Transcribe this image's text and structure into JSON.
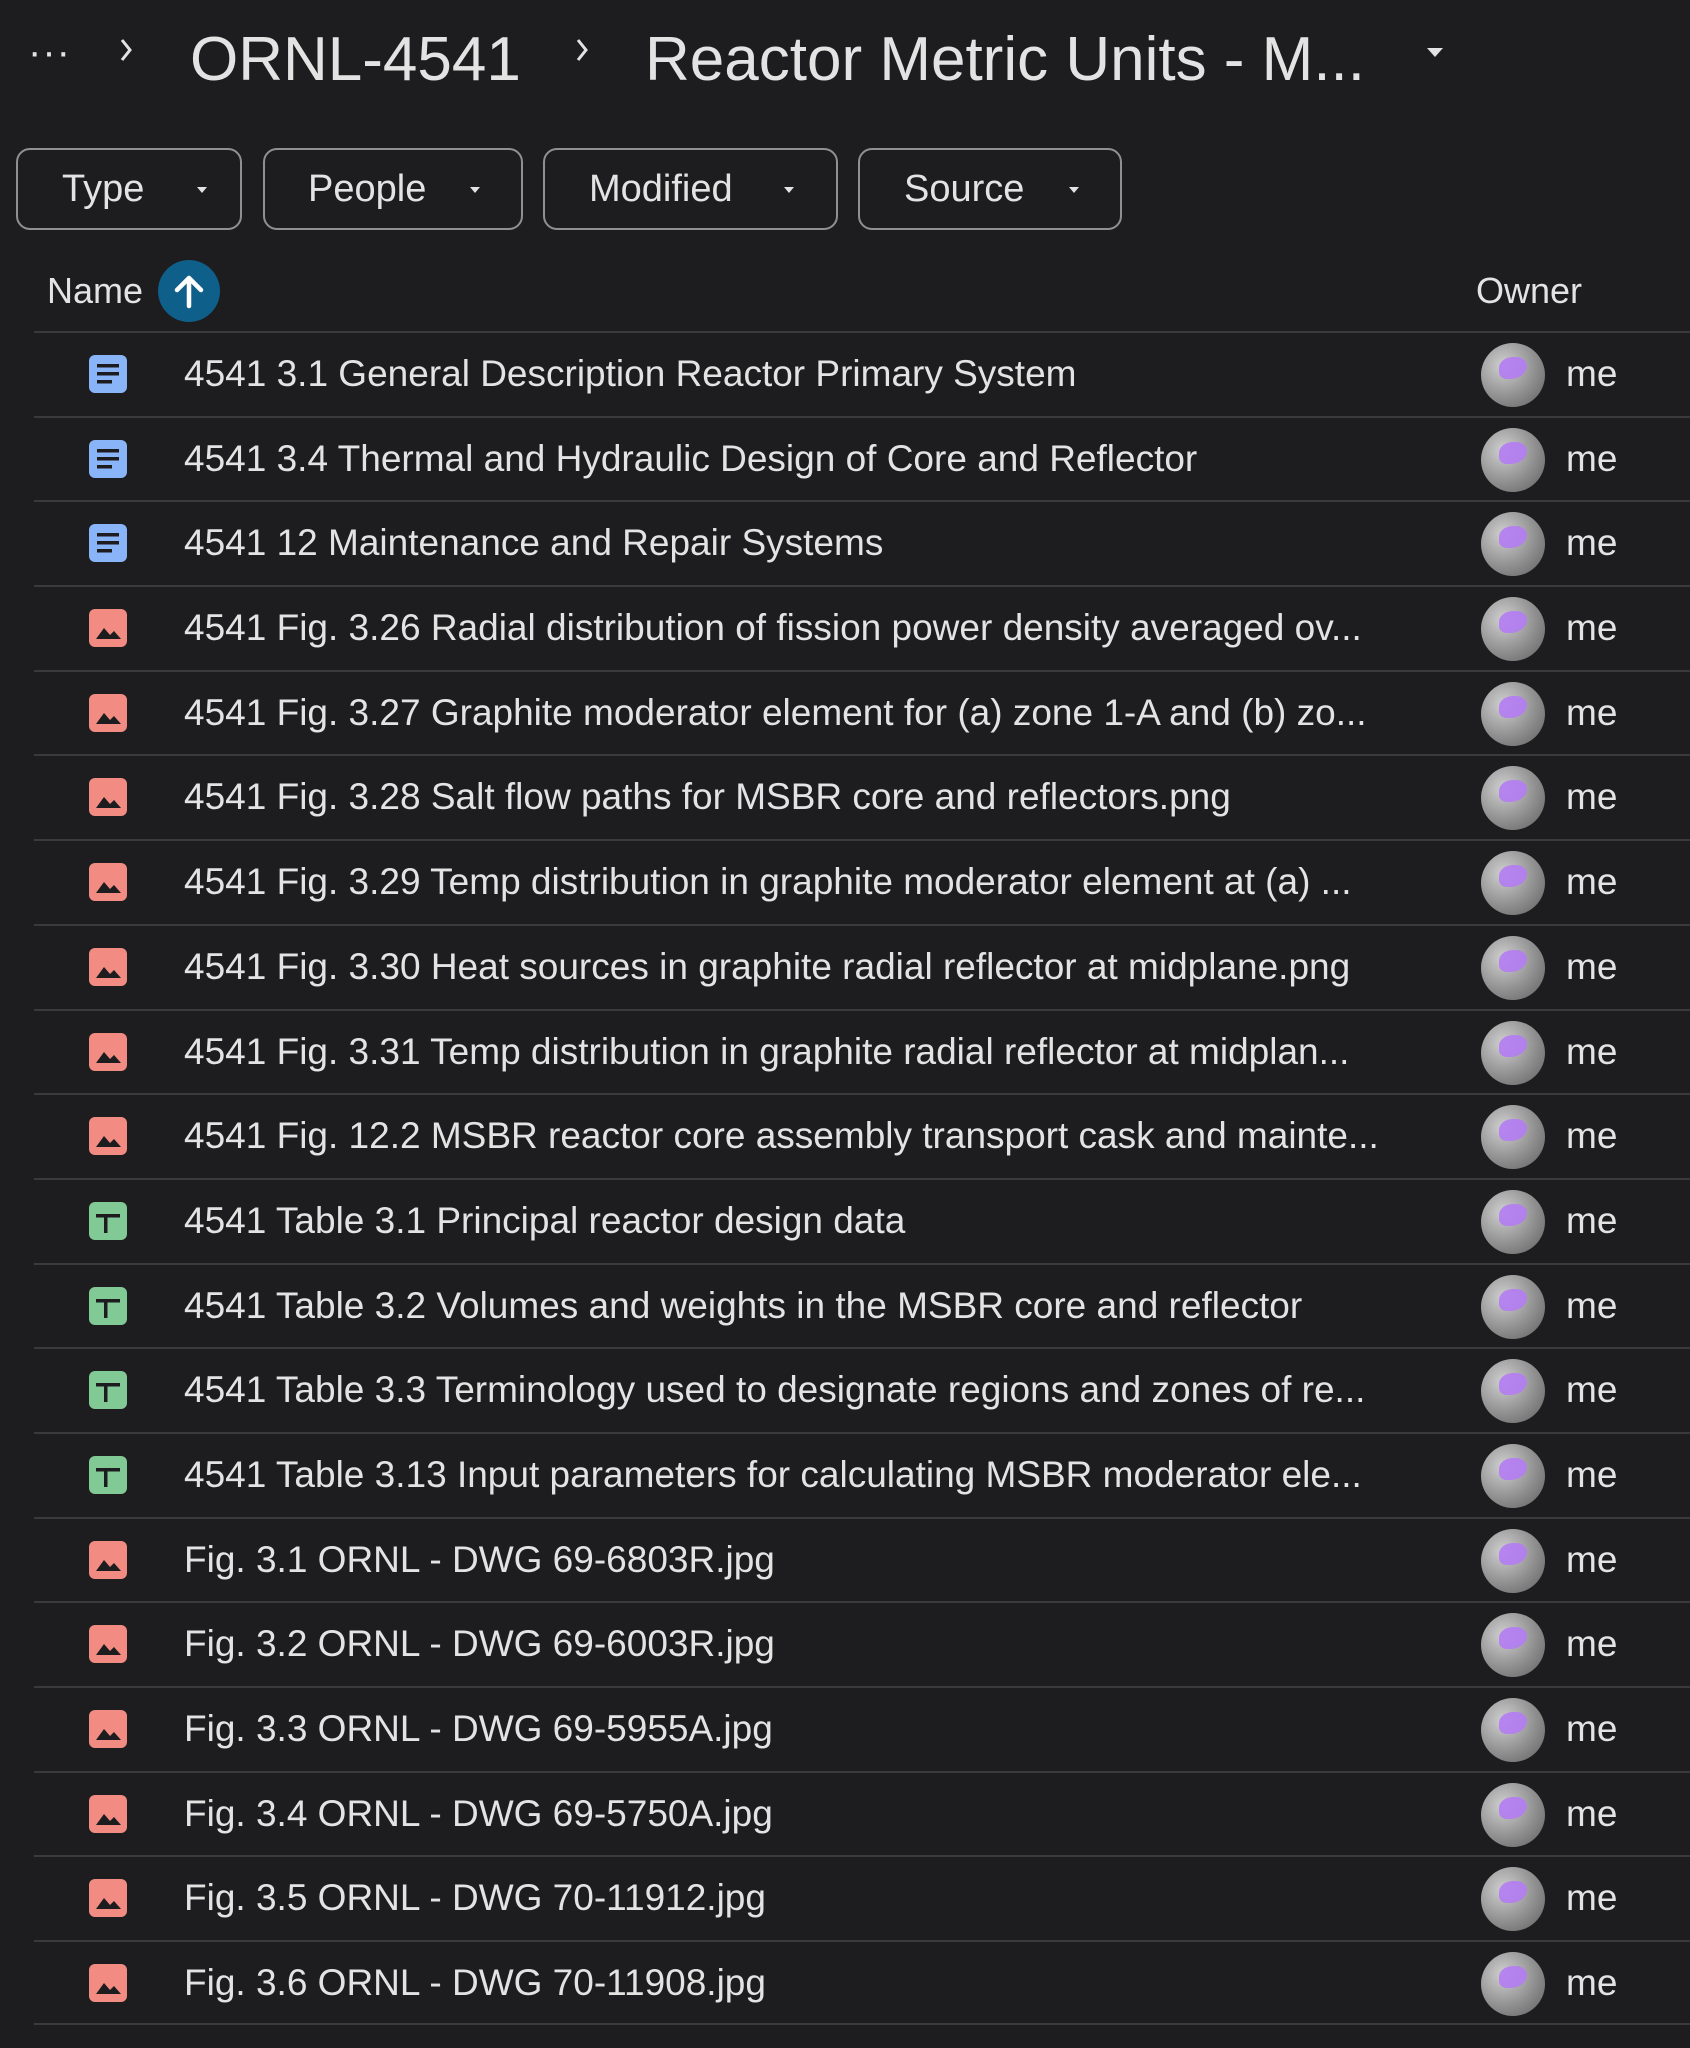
{
  "breadcrumb": {
    "more": "···",
    "items": [
      "ORNL-4541",
      "Reactor Metric Units - M..."
    ]
  },
  "filters": [
    "Type",
    "People",
    "Modified",
    "Source"
  ],
  "columns": {
    "name": "Name",
    "owner": "Owner"
  },
  "colors": {
    "doc": "#8ab4f8",
    "image": "#f28b82",
    "sheet": "#81c995",
    "sort_button": "#0e5f8a"
  },
  "files": [
    {
      "type": "doc",
      "name": "4541 3.1 General Description Reactor Primary System",
      "owner": "me"
    },
    {
      "type": "doc",
      "name": "4541 3.4 Thermal and Hydraulic Design of Core and Reflector",
      "owner": "me"
    },
    {
      "type": "doc",
      "name": "4541 12 Maintenance and Repair Systems",
      "owner": "me"
    },
    {
      "type": "image",
      "name": "4541 Fig. 3.26 Radial distribution of fission power density averaged ov...",
      "owner": "me"
    },
    {
      "type": "image",
      "name": "4541 Fig. 3.27 Graphite moderator element for (a) zone 1-A and (b) zo...",
      "owner": "me"
    },
    {
      "type": "image",
      "name": "4541 Fig. 3.28 Salt flow paths for MSBR core and reflectors.png",
      "owner": "me"
    },
    {
      "type": "image",
      "name": "4541 Fig. 3.29 Temp distribution in graphite moderator element at (a) ...",
      "owner": "me"
    },
    {
      "type": "image",
      "name": "4541 Fig. 3.30 Heat sources in graphite radial reflector at midplane.png",
      "owner": "me"
    },
    {
      "type": "image",
      "name": "4541 Fig. 3.31 Temp distribution in graphite radial reflector at midplan...",
      "owner": "me"
    },
    {
      "type": "image",
      "name": "4541 Fig. 12.2 MSBR reactor core assembly transport cask and mainte...",
      "owner": "me"
    },
    {
      "type": "sheet",
      "name": "4541 Table 3.1 Principal reactor design data",
      "owner": "me"
    },
    {
      "type": "sheet",
      "name": "4541 Table 3.2 Volumes and weights in the MSBR core and reflector",
      "owner": "me"
    },
    {
      "type": "sheet",
      "name": "4541 Table 3.3 Terminology used to designate regions and zones of re...",
      "owner": "me"
    },
    {
      "type": "sheet",
      "name": "4541 Table 3.13 Input parameters for calculating MSBR moderator ele...",
      "owner": "me"
    },
    {
      "type": "image",
      "name": "Fig. 3.1 ORNL - DWG 69-6803R.jpg",
      "owner": "me"
    },
    {
      "type": "image",
      "name": "Fig. 3.2 ORNL - DWG 69-6003R.jpg",
      "owner": "me"
    },
    {
      "type": "image",
      "name": "Fig. 3.3 ORNL - DWG 69-5955A.jpg",
      "owner": "me"
    },
    {
      "type": "image",
      "name": "Fig. 3.4 ORNL - DWG 69-5750A.jpg",
      "owner": "me"
    },
    {
      "type": "image",
      "name": "Fig. 3.5 ORNL - DWG 70-11912.jpg",
      "owner": "me"
    },
    {
      "type": "image",
      "name": "Fig. 3.6 ORNL - DWG 70-11908.jpg",
      "owner": "me"
    }
  ]
}
